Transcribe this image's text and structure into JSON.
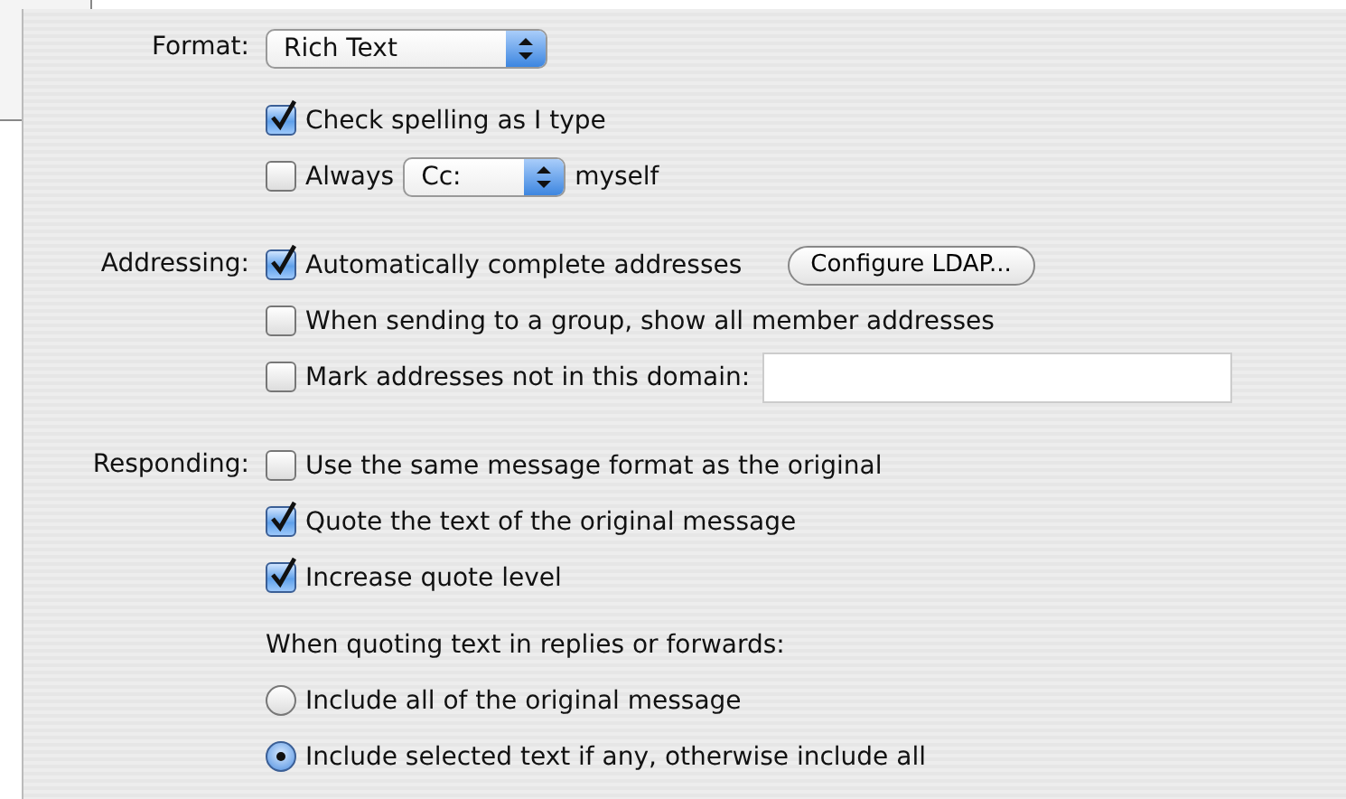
{
  "sections": [
    {
      "label": "Format:",
      "items": [
        {
          "kind": "popup",
          "value": "Rich Text"
        },
        {
          "kind": "checkbox",
          "label": "Check spelling as I type",
          "checked": true
        },
        {
          "kind": "checkbox_popup",
          "label": "Always",
          "checked": false,
          "value": "Cc:",
          "suffix": "myself"
        }
      ]
    },
    {
      "label": "Addressing:",
      "items": [
        {
          "kind": "checkbox_button",
          "label": "Automatically complete addresses",
          "checked": true,
          "button": "Configure LDAP..."
        },
        {
          "kind": "checkbox",
          "label": "When sending to a group, show all member addresses",
          "checked": false
        },
        {
          "kind": "checkbox_field",
          "label": "Mark addresses not in this domain:",
          "checked": false
        }
      ]
    },
    {
      "label": "Responding:",
      "items": [
        {
          "kind": "checkbox",
          "label": "Use the same message format as the original",
          "checked": false
        },
        {
          "kind": "checkbox",
          "label": "Quote the text of the original message",
          "checked": true
        },
        {
          "kind": "checkbox",
          "label": "Increase quote level",
          "checked": true
        },
        {
          "kind": "note",
          "label": "When quoting text in replies or forwards:"
        },
        {
          "kind": "radio",
          "label": "Include all of the original message",
          "selected": false
        },
        {
          "kind": "radio",
          "label": "Include selected text if any, otherwise include all",
          "selected": true
        }
      ]
    }
  ]
}
